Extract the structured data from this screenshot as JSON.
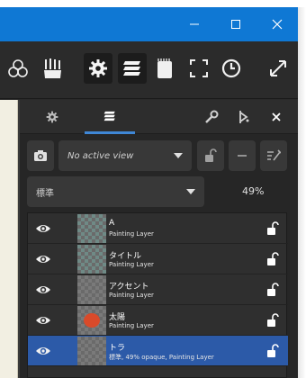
{
  "window": {
    "controls": [
      {
        "name": "minimize",
        "glyph": "—"
      },
      {
        "name": "maximize",
        "glyph": "☐"
      },
      {
        "name": "close",
        "glyph": "✕"
      }
    ]
  },
  "toolbar": {
    "icons": [
      {
        "name": "colors-icon",
        "active": false
      },
      {
        "name": "brushes-icon",
        "active": false
      },
      {
        "name": "settings-icon",
        "active": true
      },
      {
        "name": "layers-icon",
        "active": true
      },
      {
        "name": "scratchpad-icon",
        "active": false
      },
      {
        "name": "crop-frame-icon",
        "active": false
      },
      {
        "name": "history-clock-icon",
        "active": false
      },
      {
        "name": "expand-icon",
        "active": false
      }
    ]
  },
  "panel": {
    "tabs": [
      {
        "name": "tab-settings",
        "icon": "gear-icon",
        "active": false
      },
      {
        "name": "tab-layers",
        "icon": "layers-icon",
        "active": true
      }
    ],
    "tab_actions": [
      {
        "name": "wrench-icon"
      },
      {
        "name": "pin-icon"
      },
      {
        "name": "close-icon"
      }
    ],
    "view_select": {
      "value": "No active view"
    },
    "blend_mode": {
      "value": "標準"
    },
    "opacity": "49%",
    "layers": [
      {
        "name": "A",
        "type": "Painting Layer",
        "selected": false,
        "thumb": "checker-teal"
      },
      {
        "name": "タイトル",
        "type": "Painting Layer",
        "selected": false,
        "thumb": "checker-teal"
      },
      {
        "name": "アクセント",
        "type": "Painting Layer",
        "selected": false,
        "thumb": "checker"
      },
      {
        "name": "太陽",
        "type": "Painting Layer",
        "selected": false,
        "thumb": "sun-red"
      },
      {
        "name": "トラ",
        "type": "標準, 49% opaque, Painting Layer",
        "selected": true,
        "thumb": "checker"
      }
    ]
  },
  "colors": {
    "titlebar": "#0f78d4",
    "selection": "#2c5aa8",
    "tab_accent": "#3f87d6",
    "sun": "#d94a2a"
  }
}
